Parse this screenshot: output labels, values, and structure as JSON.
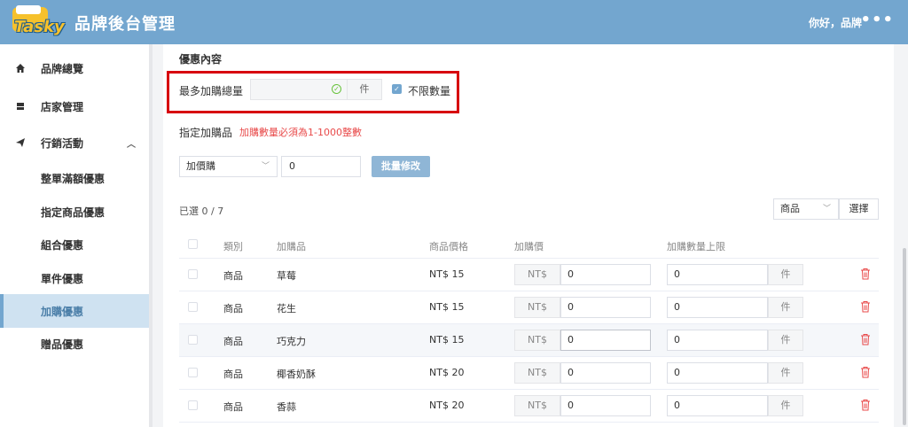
{
  "header": {
    "logo_text": "Tasky",
    "title": "品牌後台管理",
    "greeting": "你好，品牌",
    "more_glyph": "•••",
    "colors": {
      "header_bg": "#73a6cf",
      "logo_yellow": "#f6c12c"
    }
  },
  "sidebar": {
    "items": [
      {
        "label": "品牌總覽",
        "icon": "home-icon"
      },
      {
        "label": "店家管理",
        "icon": "store-icon"
      },
      {
        "label": "行銷活動",
        "icon": "send-icon",
        "expanded": true,
        "chevron": "︿"
      }
    ],
    "subitems": [
      {
        "label": "整單滿額優惠"
      },
      {
        "label": "指定商品優惠"
      },
      {
        "label": "組合優惠"
      },
      {
        "label": "單件優惠"
      },
      {
        "label": "加購優惠",
        "active": true
      },
      {
        "label": "贈品優惠"
      }
    ]
  },
  "offer": {
    "section_title": "優惠內容",
    "max_total_label": "最多加購總量",
    "max_total_value": "",
    "max_total_unit": "件",
    "unlimited_label": "不限數量",
    "unlimited_checked": true,
    "check_glyph": "✓"
  },
  "specified": {
    "label": "指定加購品",
    "hint": "加購數量必須為1-1000整數",
    "type_select": "加價購",
    "number_value": "0",
    "batch_button": "批量修改",
    "chev": "﹀"
  },
  "list": {
    "selected_count": "已選 0 / 7",
    "product_select": "商品",
    "choose_button": "選擇",
    "headers": {
      "category": "類別",
      "item": "加購品",
      "price": "商品價格",
      "addon_price": "加購價",
      "limit": "加購數量上限"
    },
    "currency_prefix": "NT$",
    "unit": "件",
    "rows": [
      {
        "category": "商品",
        "item": "草莓",
        "price": "NT$ 15",
        "addon_price": "0",
        "limit": "0"
      },
      {
        "category": "商品",
        "item": "花生",
        "price": "NT$ 15",
        "addon_price": "0",
        "limit": "0"
      },
      {
        "category": "商品",
        "item": "巧克力",
        "price": "NT$ 15",
        "addon_price": "0",
        "limit": "0"
      },
      {
        "category": "商品",
        "item": "椰香奶酥",
        "price": "NT$ 20",
        "addon_price": "0",
        "limit": "0"
      },
      {
        "category": "商品",
        "item": "香蒜",
        "price": "NT$ 20",
        "addon_price": "0",
        "limit": "0"
      }
    ]
  },
  "colors": {
    "highlight_border": "#d7000f",
    "hint_red": "#e84a4a",
    "active_bg": "#cfe2f1",
    "button_blue": "#8fb6d6",
    "delete_red": "#e84a4a"
  }
}
